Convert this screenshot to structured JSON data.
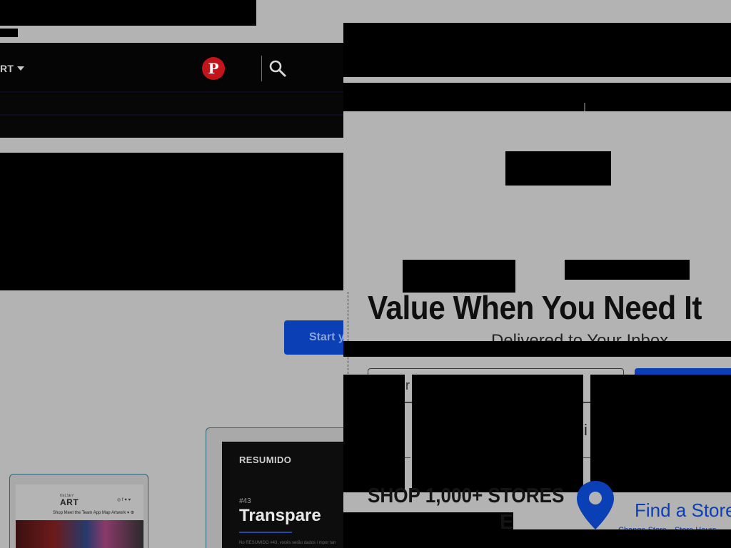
{
  "nav": {
    "art_label": "RT",
    "pinterest_letter": "P"
  },
  "hero": {
    "start_label": "Start y"
  },
  "cards": {
    "kelsey": {
      "logo": "ART",
      "small": "KELSEY",
      "social": "◎ f ♥ ♥",
      "menu": "Shop  Meet the Team  App  Map  Artwork ▾  ⚙"
    },
    "resumido": {
      "title": "RESUMIDO",
      "subtitle": "",
      "number": "#43",
      "headline": "Transpare",
      "body": "No RESUMIDO #43, vocês serão dados i mpor tan"
    }
  },
  "popup": {
    "headline": "Value When You Need It",
    "subheadline": "Delivered to Your Inbox",
    "email_placeholder": "r",
    "frag_text_1": "i",
    "shop_heading": "SHOP 1,000+ STORES",
    "shop_heading_2": "E",
    "find_store": "Find a Store",
    "store_links": [
      "Change Store",
      "Store Hours"
    ]
  },
  "colors": {
    "accent": "#0b3fb5",
    "pinterest": "#c3141c",
    "overlay": "#b3b3b3"
  }
}
